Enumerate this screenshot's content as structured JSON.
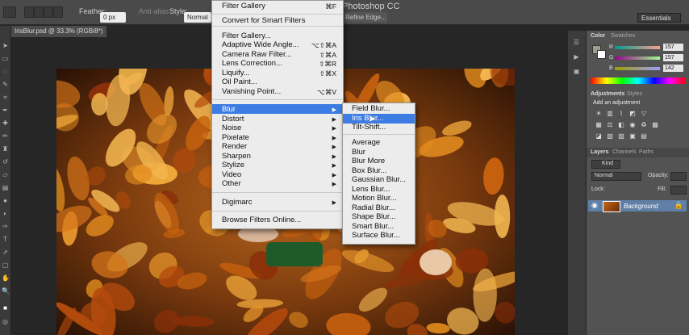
{
  "app": {
    "name": "Photoshop CC"
  },
  "optionsbar": {
    "feather_label": "Feather:",
    "feather_value": "0 px",
    "antialias_label": "Anti-alias",
    "style_label": "Style:",
    "style_value": "Normal",
    "refine_edge": "Refine Edge...",
    "workspace": "Essentials"
  },
  "document": {
    "tab": "IrisBlur.psd @ 33.3% (RGB/8*)"
  },
  "filter_menu": {
    "items": [
      {
        "label": "Filter Gallery",
        "shortcut": "⌘F"
      },
      {
        "label": "Convert for Smart Filters",
        "shortcut": ""
      },
      {
        "label": "Filter Gallery...",
        "shortcut": ""
      },
      {
        "label": "Adaptive Wide Angle...",
        "shortcut": "⌥⇧⌘A"
      },
      {
        "label": "Camera Raw Filter...",
        "shortcut": "⇧⌘A"
      },
      {
        "label": "Lens Correction...",
        "shortcut": "⇧⌘R"
      },
      {
        "label": "Liquify...",
        "shortcut": "⇧⌘X"
      },
      {
        "label": "Oil Paint...",
        "shortcut": ""
      },
      {
        "label": "Vanishing Point...",
        "shortcut": "⌥⌘V"
      },
      {
        "label": "Blur",
        "shortcut": ""
      },
      {
        "label": "Distort",
        "shortcut": ""
      },
      {
        "label": "Noise",
        "shortcut": ""
      },
      {
        "label": "Pixelate",
        "shortcut": ""
      },
      {
        "label": "Render",
        "shortcut": ""
      },
      {
        "label": "Sharpen",
        "shortcut": ""
      },
      {
        "label": "Stylize",
        "shortcut": ""
      },
      {
        "label": "Video",
        "shortcut": ""
      },
      {
        "label": "Other",
        "shortcut": ""
      },
      {
        "label": "Digimarc",
        "shortcut": ""
      },
      {
        "label": "Browse Filters Online...",
        "shortcut": ""
      }
    ]
  },
  "blur_submenu": {
    "items": [
      "Field Blur...",
      "Iris Blur...",
      "Tilt-Shift...",
      "Average",
      "Blur",
      "Blur More",
      "Box Blur...",
      "Gaussian Blur...",
      "Lens Blur...",
      "Motion Blur...",
      "Radial Blur...",
      "Shape Blur...",
      "Smart Blur...",
      "Surface Blur..."
    ],
    "selected": "Iris Blur..."
  },
  "color_panel": {
    "tabs": [
      "Color",
      "Swatches"
    ],
    "r": "157",
    "g": "157",
    "b": "142",
    "r_label": "R",
    "g_label": "G",
    "b_label": "B"
  },
  "adjustments_panel": {
    "tabs": [
      "Adjustments",
      "Styles"
    ],
    "heading": "Add an adjustment"
  },
  "layers_panel": {
    "tabs": [
      "Layers",
      "Channels",
      "Paths"
    ],
    "kind": "Kind",
    "blend": "Normal",
    "opacity_label": "Opacity:",
    "lock_label": "Lock:",
    "fill_label": "Fill:",
    "layer_name": "Background"
  },
  "colors": {
    "accent": "#3d7ce2",
    "menu_bg": "#ececec",
    "chrome": "#4a4a4a"
  }
}
